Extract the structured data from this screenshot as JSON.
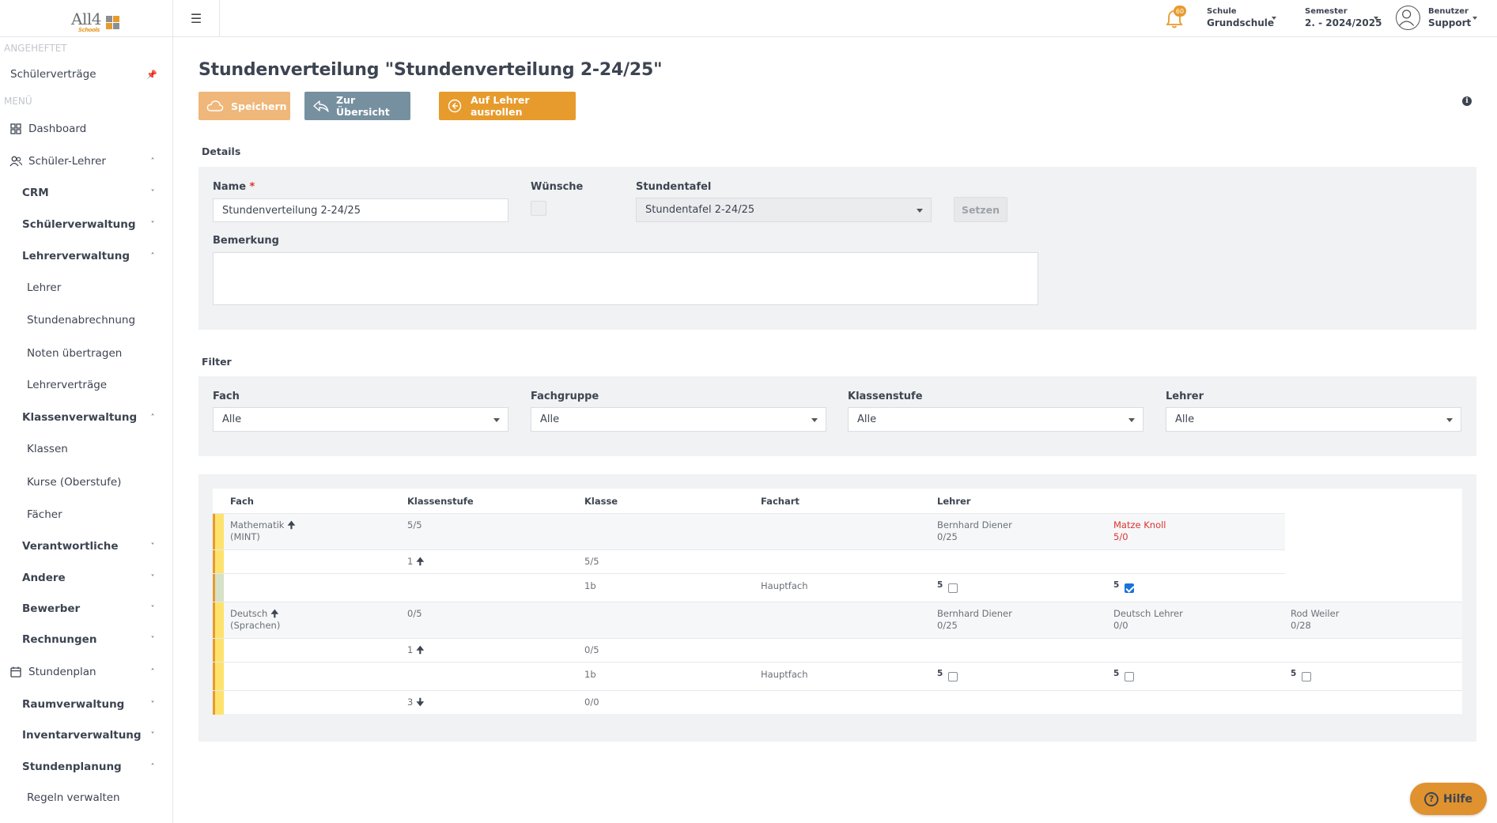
{
  "header": {
    "logo_text": "All4",
    "logo_sub": "Schools",
    "notification_count": "60",
    "school_label": "Schule",
    "school_value": "Grundschule",
    "semester_label": "Semester",
    "semester_value": "2. - 2024/2025",
    "user_label": "Benutzer",
    "user_value": "Support"
  },
  "sidebar": {
    "pinned_heading": "ANGEHEFTET",
    "pinned_item": "Schülerverträge",
    "menu_heading": "MENÜ",
    "items": [
      {
        "label": "Dashboard"
      },
      {
        "label": "Schüler-Lehrer"
      },
      {
        "label": "CRM"
      },
      {
        "label": "Schülerverwaltung"
      },
      {
        "label": "Lehrerverwaltung"
      },
      {
        "label": "Lehrer"
      },
      {
        "label": "Stundenabrechnung"
      },
      {
        "label": "Noten übertragen"
      },
      {
        "label": "Lehrerverträge"
      },
      {
        "label": "Klassenverwaltung"
      },
      {
        "label": "Klassen"
      },
      {
        "label": "Kurse (Oberstufe)"
      },
      {
        "label": "Fächer"
      },
      {
        "label": "Verantwortliche"
      },
      {
        "label": "Andere"
      },
      {
        "label": "Bewerber"
      },
      {
        "label": "Rechnungen"
      },
      {
        "label": "Stundenplan"
      },
      {
        "label": "Raumverwaltung"
      },
      {
        "label": "Inventarverwaltung"
      },
      {
        "label": "Stundenplanung"
      },
      {
        "label": "Regeln verwalten"
      }
    ]
  },
  "page": {
    "title": "Stundenverteilung \"Stundenverteilung 2-24/25\"",
    "buttons": {
      "save": "Speichern",
      "overview": "Zur Übersicht",
      "rollout": "Auf Lehrer ausrollen"
    },
    "colors": {
      "save_bg": "#efb779",
      "overview_bg": "#7690a0",
      "rollout_bg": "#e79b2c",
      "bar_yellow": "#fde36e",
      "bar_orange": "#e79b2c",
      "bar_green": "#d5e2c8"
    }
  },
  "details": {
    "section_label": "Details",
    "name_label": "Name",
    "name_required": "*",
    "name_value": "Stundenverteilung 2-24/25",
    "wishes_label": "Wünsche",
    "table_label": "Stundentafel",
    "table_value": "Stundentafel 2-24/25",
    "set_button": "Setzen",
    "remark_label": "Bemerkung"
  },
  "filter": {
    "section_label": "Filter",
    "fields": [
      {
        "label": "Fach",
        "value": "Alle"
      },
      {
        "label": "Fachgruppe",
        "value": "Alle"
      },
      {
        "label": "Klassenstufe",
        "value": "Alle"
      },
      {
        "label": "Lehrer",
        "value": "Alle"
      }
    ]
  },
  "table": {
    "headers": [
      "Fach",
      "Klassenstufe",
      "Klasse",
      "Fachart",
      "Lehrer"
    ],
    "mathe": {
      "subject": "Mathematik",
      "group": "(MINT)",
      "ratio": "5/5",
      "teacher1_name": "Bernhard Diener",
      "teacher1_ratio": "0/25",
      "teacher2_name": "Matze Knoll",
      "teacher2_ratio": "5/0",
      "level_row": {
        "level": "1",
        "ratio": "5/5"
      },
      "class_row": {
        "class": "1b",
        "type": "Hauptfach",
        "h1": "5",
        "h2": "5"
      }
    },
    "deutsch": {
      "subject": "Deutsch",
      "group": "(Sprachen)",
      "ratio": "0/5",
      "teacher1_name": "Bernhard Diener",
      "teacher1_ratio": "0/25",
      "teacher2_name": "Deutsch Lehrer",
      "teacher2_ratio": "0/0",
      "teacher3_name": "Rod Weiler",
      "teacher3_ratio": "0/28",
      "level_row": {
        "level": "1",
        "ratio": "0/5"
      },
      "class_row": {
        "class": "1b",
        "type": "Hauptfach",
        "h1": "5",
        "h2": "5",
        "h3": "5"
      },
      "level3_row": {
        "level": "3",
        "ratio": "0/0"
      }
    }
  },
  "help_button": "Hilfe"
}
